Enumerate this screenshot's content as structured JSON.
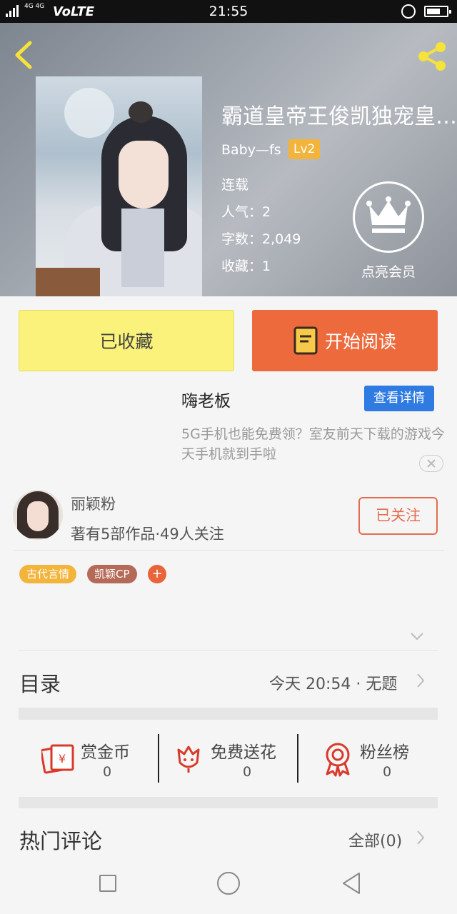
{
  "status_bar": {
    "network": "4G 4G",
    "carrier_tag": "VoLTE",
    "time": "21:55"
  },
  "book": {
    "title": "霸道皇帝王俊凯独宠皇…",
    "author": "Baby—fs",
    "level": "Lv2",
    "status": "连载",
    "popularity": "人气：2",
    "word_count": "字数：2,049",
    "favorites": "收藏：1",
    "vip_label": "点亮会员"
  },
  "actions": {
    "collected_label": "已收藏",
    "read_label": "开始阅读"
  },
  "ad": {
    "title": "嗨老板",
    "button": "查看详情",
    "description": "5G手机也能免费领？室友前天下载的游戏今天手机就到手啦"
  },
  "author_card": {
    "name": "丽颖粉",
    "stats": "著有5部作品·49人关注",
    "follow_label": "已关注"
  },
  "tags": [
    {
      "label": "古代言情",
      "color": "#f3b43b"
    },
    {
      "label": "凯颖CP",
      "color": "#b56a58"
    }
  ],
  "tag_add": "+",
  "catalog": {
    "title": "目录",
    "latest": "今天 20:54 · 无题"
  },
  "stats": [
    {
      "label": "赏金币",
      "value": "0"
    },
    {
      "label": "免费送花",
      "value": "0"
    },
    {
      "label": "粉丝榜",
      "value": "0"
    }
  ],
  "comments": {
    "title": "热门评论",
    "all_label": "全部(0)"
  },
  "colors": {
    "accent_orange": "#ec6a3c",
    "collect_yellow": "#faf27a",
    "follow_red": "#e46d4f",
    "ad_blue": "#2f7be2",
    "stat_red": "#d83a2a"
  }
}
